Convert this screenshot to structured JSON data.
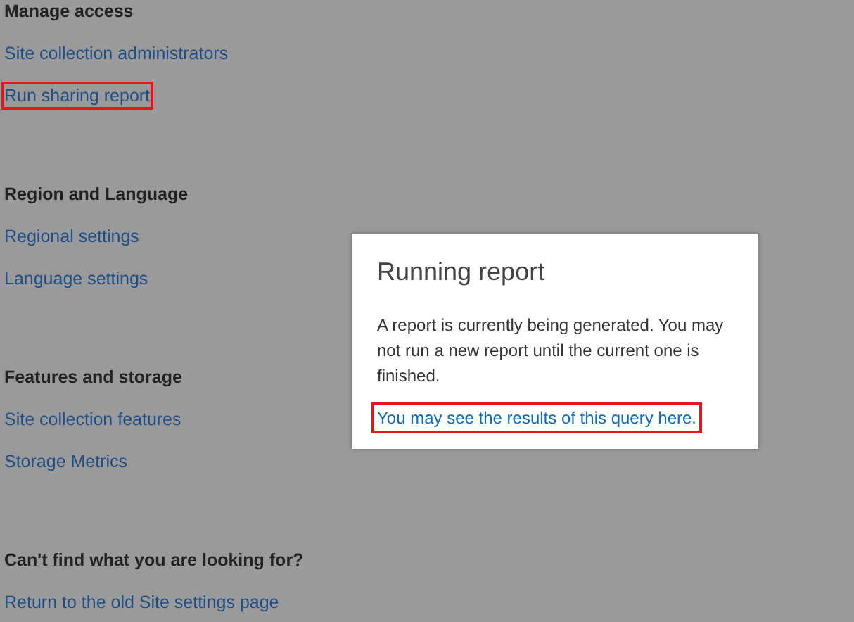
{
  "sections": [
    {
      "heading": "Manage access",
      "links": [
        {
          "label": "Site collection administrators",
          "highlighted": false
        },
        {
          "label": "Run sharing report",
          "highlighted": true
        }
      ]
    },
    {
      "heading": "Region and Language",
      "links": [
        {
          "label": "Regional settings",
          "highlighted": false
        },
        {
          "label": "Language settings",
          "highlighted": false
        }
      ]
    },
    {
      "heading": "Features and storage",
      "links": [
        {
          "label": "Site collection features",
          "highlighted": false
        },
        {
          "label": "Storage Metrics",
          "highlighted": false
        }
      ]
    },
    {
      "heading": "Can't find what you are looking for?",
      "links": [
        {
          "label": "Return to the old Site settings page",
          "highlighted": false
        }
      ]
    }
  ],
  "dialog": {
    "title": "Running report",
    "message": "A report is currently being generated. You may not run a new report until the current one is finished.",
    "link": {
      "label": "You may see the results of this query here.",
      "highlighted": true
    }
  }
}
